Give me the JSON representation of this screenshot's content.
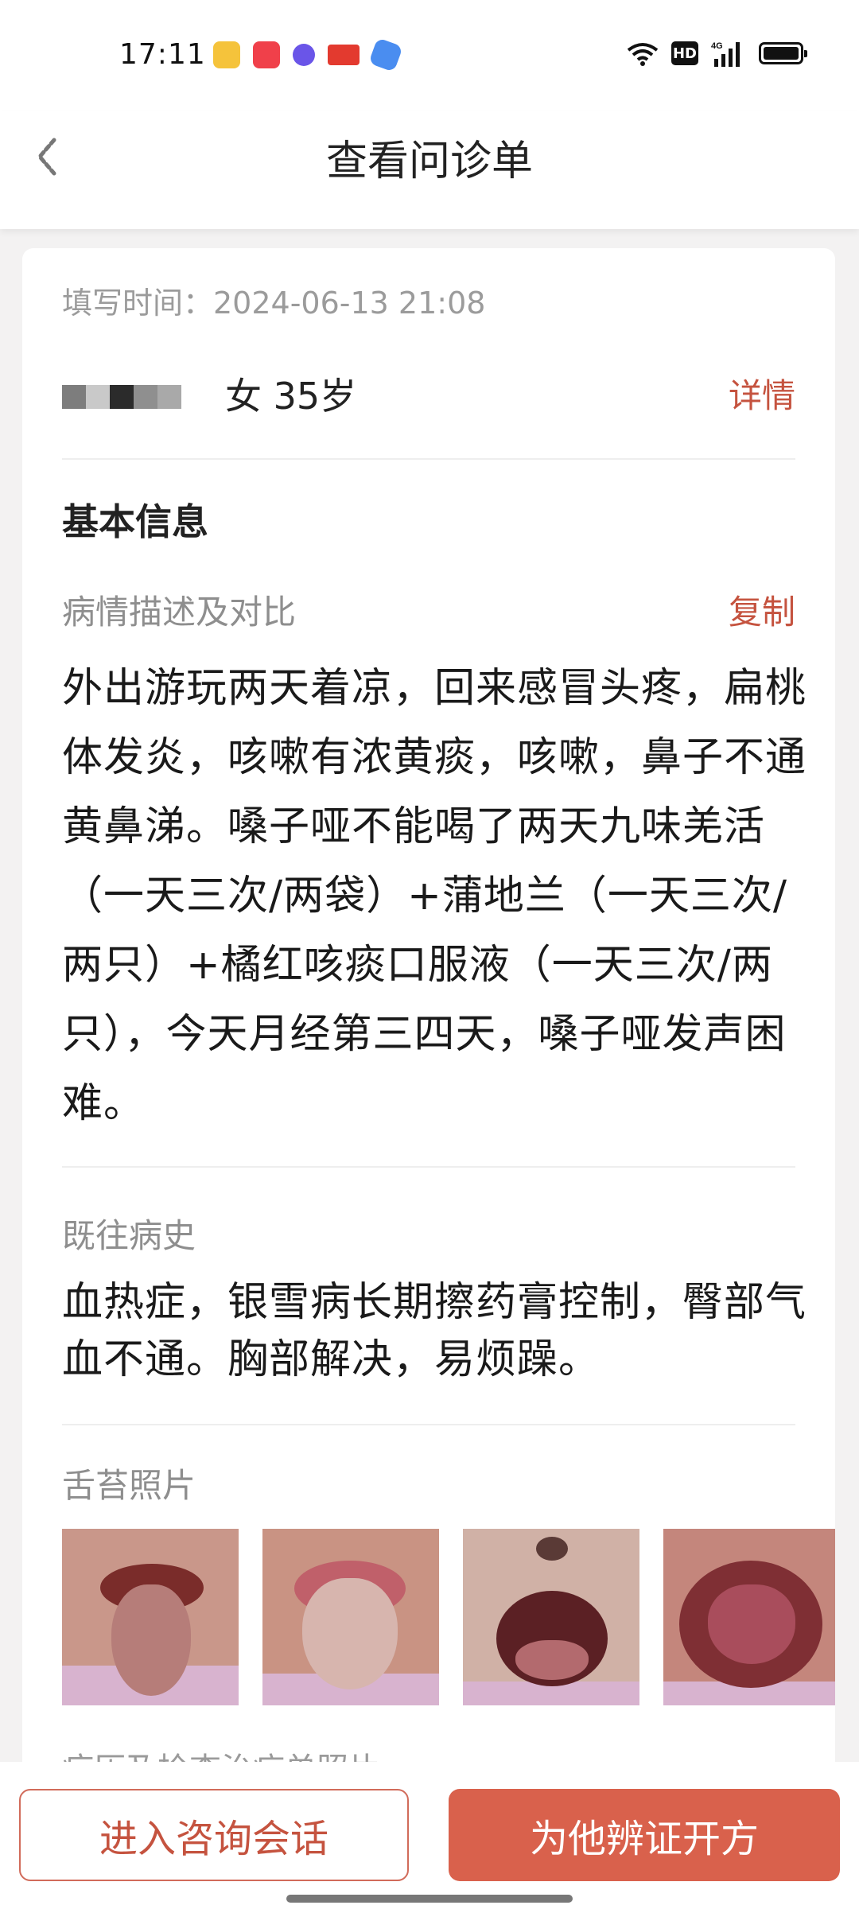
{
  "status_bar": {
    "time": "17:11",
    "app_icons": [
      "weibo-icon",
      "music-icon",
      "chat-icon",
      "toutiao-icon",
      "browser-icon"
    ],
    "hd_label": "HD",
    "network": "4G"
  },
  "header": {
    "title": "查看问诊单"
  },
  "card": {
    "fill_time": "填写时间：2024-06-13 21:08",
    "patient": {
      "gender_age": "女 35岁",
      "detail_link": "详情"
    },
    "section_title": "基本信息",
    "condition": {
      "label": "病情描述及对比",
      "copy_link": "复制",
      "text": "外出游玩两天着凉，回来感冒头疼，扁桃体发炎，咳嗽有浓黄痰，咳嗽，鼻子不通黄鼻涕。嗓子哑不能喝了两天九味羌活（一天三次/两袋）+蒲地兰（一天三次/两只）+橘红咳痰口服液（一天三次/两只），今天月经第三四天，嗓子哑发声困难。"
    },
    "history": {
      "label": "既往病史",
      "text": "血热症，银雪病长期擦药膏控制，臀部气血不通。胸部解决，易烦躁。"
    },
    "tongue_photos": {
      "label": "舌苔照片",
      "count": 4
    },
    "records_label": "病历及检查治疗单照片"
  },
  "bottom_bar": {
    "consult_button": "进入咨询会话",
    "prescribe_button": "为他辨证开方"
  },
  "colors": {
    "accent": "#c5533f",
    "primary_button": "#d9614c",
    "background": "#f3f2f2"
  }
}
